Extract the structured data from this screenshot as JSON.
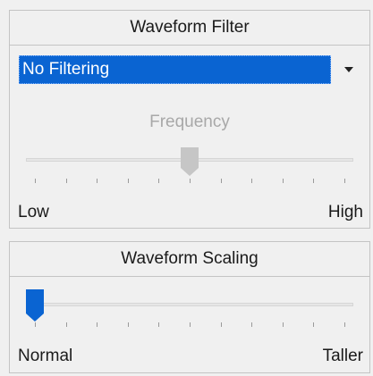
{
  "filter": {
    "title": "Waveform Filter",
    "selected": "No Filtering",
    "slider": {
      "label": "Frequency",
      "min_label": "Low",
      "max_label": "High",
      "value": 0.5,
      "enabled": false
    }
  },
  "scaling": {
    "title": "Waveform Scaling",
    "slider": {
      "min_label": "Normal",
      "max_label": "Taller",
      "value": 0.0,
      "enabled": true
    }
  },
  "colors": {
    "selection": "#0a64d2",
    "thumb_active": "#0a64d2",
    "thumb_disabled": "#c6c6c6"
  },
  "icons": {
    "dropdown": "chevron-down-icon"
  }
}
